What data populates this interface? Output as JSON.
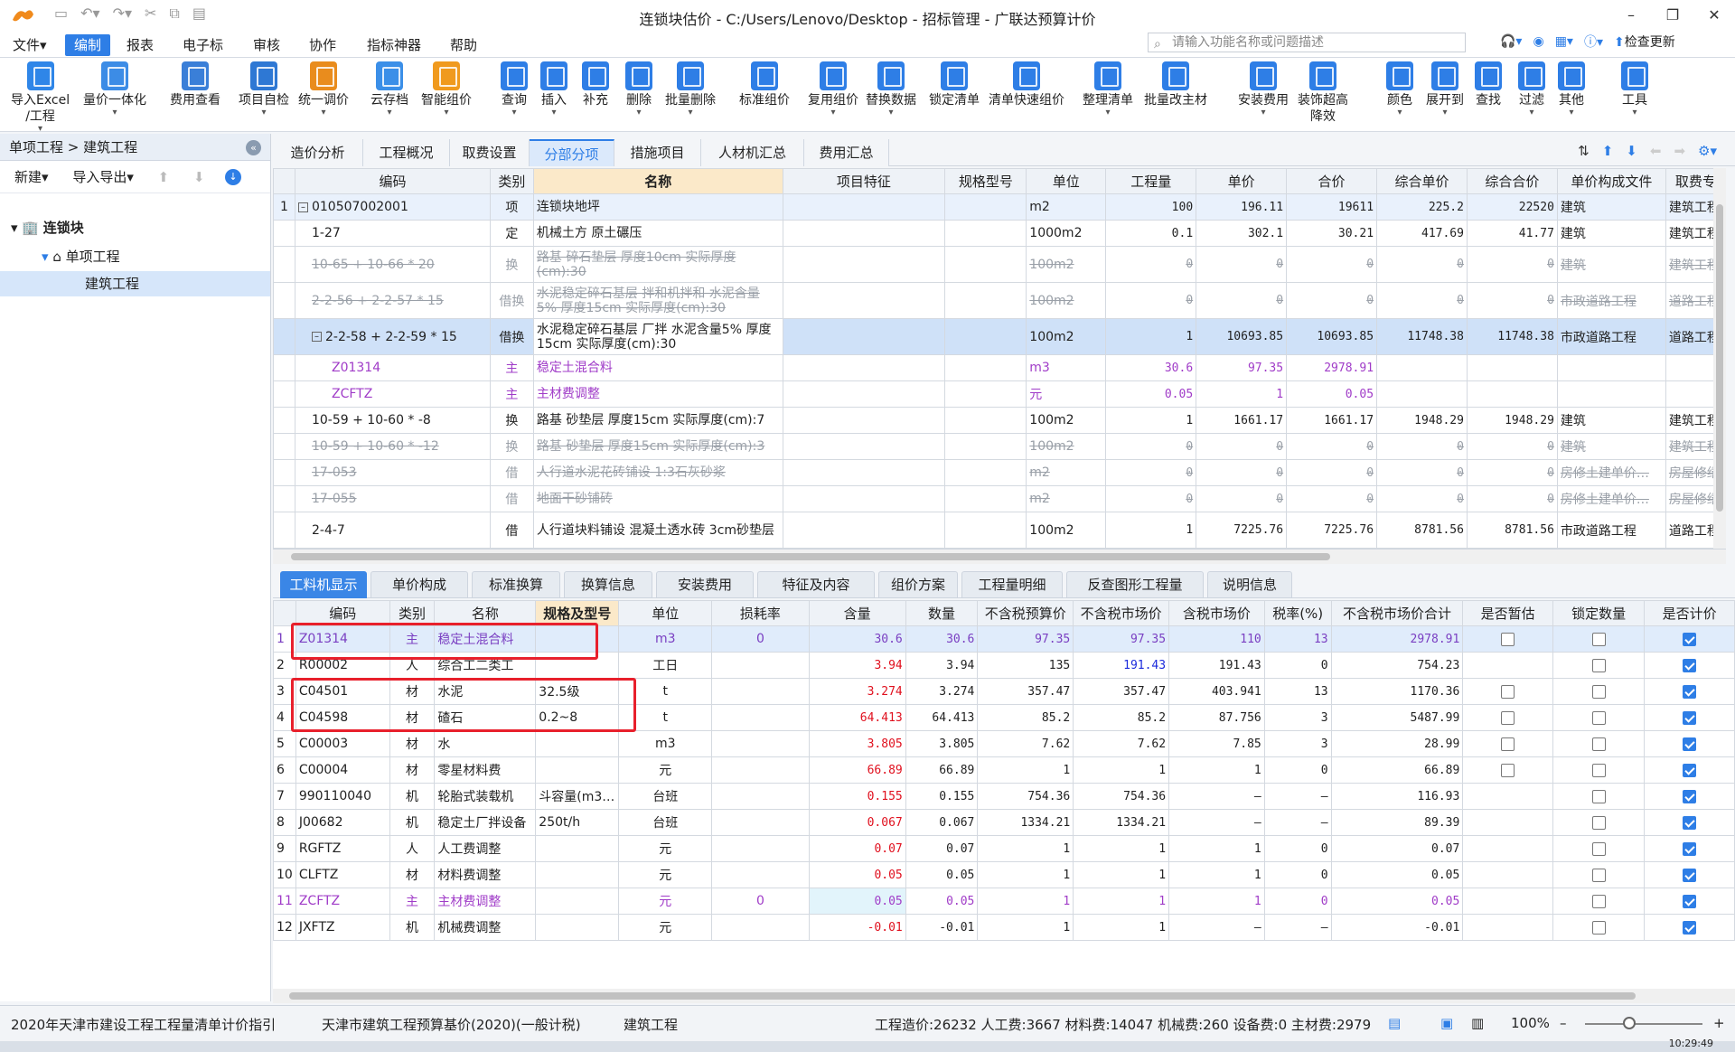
{
  "window": {
    "title": "连锁块估价 - C:/Users/Lenovo/Desktop - 招标管理 - 广联达预算计价"
  },
  "menu": [
    "文件▾",
    "编制",
    "报表",
    "电子标",
    "审核",
    "协作",
    "指标神器",
    "帮助"
  ],
  "search": {
    "placeholder": "请输入功能名称或问题描述"
  },
  "menu_right": {
    "check_update": "检查更新"
  },
  "ribbon": [
    {
      "label": "导入Excel\n/工程",
      "color": "#2f86e8"
    },
    {
      "label": "量价一体化",
      "color": "#3c8ce6"
    },
    {
      "label": "费用查看",
      "color": "#3a7fd8"
    },
    {
      "label": "项目自检",
      "color": "#2e78d4"
    },
    {
      "label": "统一调价",
      "color": "#e98c1d"
    },
    {
      "label": "云存档",
      "color": "#3b8fe8"
    },
    {
      "label": "智能组价",
      "color": "#f09a1e"
    },
    {
      "label": "查询",
      "color": "#2e7ee6"
    },
    {
      "label": "插入",
      "color": "#2e7ee6"
    },
    {
      "label": "补充",
      "color": "#2e7ee6"
    },
    {
      "label": "删除",
      "color": "#2e7ee6"
    },
    {
      "label": "批量删除",
      "color": "#2e7ee6"
    },
    {
      "label": "标准组价",
      "color": "#2e7ee6"
    },
    {
      "label": "复用组价",
      "color": "#2e7ee6"
    },
    {
      "label": "替换数据",
      "color": "#2e7ee6"
    },
    {
      "label": "锁定清单",
      "color": "#2e7ee6"
    },
    {
      "label": "清单快速组价",
      "color": "#2e7ee6"
    },
    {
      "label": "整理清单",
      "color": "#2e7ee6"
    },
    {
      "label": "批量改主材",
      "color": "#2e7ee6"
    },
    {
      "label": "安装费用",
      "color": "#2e7ee6"
    },
    {
      "label": "装饰超高\n降效",
      "color": "#2e7ee6"
    },
    {
      "label": "颜色",
      "color": "#2e7ee6"
    },
    {
      "label": "展开到",
      "color": "#2e7ee6"
    },
    {
      "label": "查找",
      "color": "#2e7ee6"
    },
    {
      "label": "过滤",
      "color": "#2e7ee6"
    },
    {
      "label": "其他",
      "color": "#2e7ee6"
    },
    {
      "label": "工具",
      "color": "#2e7ee6"
    }
  ],
  "left": {
    "breadcrumb": "单项工程 > 建筑工程",
    "new": "新建▾",
    "import_export": "导入导出▾",
    "tree": {
      "root": "连锁块",
      "sub": "单项工程",
      "leaf": "建筑工程"
    }
  },
  "top_tabs": [
    "造价分析",
    "工程概况",
    "取费设置",
    "分部分项",
    "措施项目",
    "人材机汇总",
    "费用汇总"
  ],
  "top_table": {
    "headers": [
      "",
      "编码",
      "类别",
      "名称",
      "项目特征",
      "规格型号",
      "单位",
      "工程量",
      "单价",
      "合价",
      "综合单价",
      "综合合价",
      "单价构成文件",
      "取费专"
    ],
    "rows": [
      [
        "1",
        "010507002001",
        "项",
        "连锁块地坪",
        "",
        "",
        "m2",
        "100",
        "196.11",
        "19611",
        "225.2",
        "22520",
        "建筑",
        "建筑工程"
      ],
      [
        "",
        "1-27",
        "定",
        "机械土方 原土碾压",
        "",
        "",
        "1000m2",
        "0.1",
        "302.1",
        "30.21",
        "417.69",
        "41.77",
        "建筑",
        "建筑工程"
      ],
      [
        "",
        "10-65 + 10-66 * 20",
        "换",
        "路基 碎石垫层 厚度10cm 实际厚度(cm):30",
        "",
        "",
        "100m2",
        "0",
        "0",
        "0",
        "0",
        "0",
        "建筑",
        "建筑工程"
      ],
      [
        "",
        "2-2-56 + 2-2-57 * 15",
        "借换",
        "水泥稳定碎石基层 拌和机拌和 水泥含量5% 厚度15cm 实际厚度(cm):30",
        "",
        "",
        "100m2",
        "0",
        "0",
        "0",
        "0",
        "0",
        "市政道路工程",
        "道路工程"
      ],
      [
        "",
        "2-2-58 + 2-2-59 * 15",
        "借换",
        "水泥稳定碎石基层 厂拌 水泥含量5% 厚度15cm 实际厚度(cm):30",
        "",
        "",
        "100m2",
        "1",
        "10693.85",
        "10693.85",
        "11748.38",
        "11748.38",
        "市政道路工程",
        "道路工程"
      ],
      [
        "",
        "Z01314",
        "主",
        "稳定土混合料",
        "",
        "",
        "m3",
        "30.6",
        "97.35",
        "2978.91",
        "",
        "",
        "",
        ""
      ],
      [
        "",
        "ZCFTZ",
        "主",
        "主材费调整",
        "",
        "",
        "元",
        "0.05",
        "1",
        "0.05",
        "",
        "",
        "",
        ""
      ],
      [
        "",
        "10-59 + 10-60 * -8",
        "换",
        "路基 砂垫层 厚度15cm 实际厚度(cm):7",
        "",
        "",
        "100m2",
        "1",
        "1661.17",
        "1661.17",
        "1948.29",
        "1948.29",
        "建筑",
        "建筑工程"
      ],
      [
        "",
        "10-59 + 10-60 * -12",
        "换",
        "路基 砂垫层 厚度15cm 实际厚度(cm):3",
        "",
        "",
        "100m2",
        "0",
        "0",
        "0",
        "0",
        "0",
        "建筑",
        "建筑工程"
      ],
      [
        "",
        "17-053",
        "借",
        "人行道水泥花砖铺设 1:3石灰砂浆",
        "",
        "",
        "m2",
        "0",
        "0",
        "0",
        "0",
        "0",
        "房修土建单价…",
        "房屋修缮"
      ],
      [
        "",
        "17-055",
        "借",
        "地面干砂铺砖",
        "",
        "",
        "m2",
        "0",
        "0",
        "0",
        "0",
        "0",
        "房修土建单价…",
        "房屋修缮"
      ],
      [
        "",
        "2-4-7",
        "借",
        "人行道块料铺设 混凝土透水砖 3cm砂垫层",
        "",
        "",
        "100m2",
        "1",
        "7225.76",
        "7225.76",
        "8781.56",
        "8781.56",
        "市政道路工程",
        "道路工程"
      ]
    ]
  },
  "bottom_tabs": [
    "工料机显示",
    "单价构成",
    "标准换算",
    "换算信息",
    "安装费用",
    "特征及内容",
    "组价方案",
    "工程量明细",
    "反查图形工程量",
    "说明信息"
  ],
  "bottom_table": {
    "headers": [
      "",
      "编码",
      "类别",
      "名称",
      "规格及型号",
      "单位",
      "损耗率",
      "含量",
      "数量",
      "不含税预算价",
      "不含税市场价",
      "含税市场价",
      "税率(%)",
      "不含税市场价合计",
      "是否暂估",
      "锁定数量",
      "是否计价"
    ],
    "rows": [
      [
        "1",
        "Z01314",
        "主",
        "稳定土混合料",
        "",
        "m3",
        "0",
        "30.6",
        "30.6",
        "97.35",
        "97.35",
        "110",
        "13",
        "2978.91",
        false,
        false,
        true
      ],
      [
        "2",
        "R00002",
        "人",
        "综合工二类工",
        "",
        "工日",
        "",
        "3.94",
        "3.94",
        "135",
        "191.43",
        "191.43",
        "0",
        "754.23",
        null,
        false,
        true
      ],
      [
        "3",
        "C04501",
        "材",
        "水泥",
        "32.5级",
        "t",
        "",
        "3.274",
        "3.274",
        "357.47",
        "357.47",
        "403.941",
        "13",
        "1170.36",
        false,
        false,
        true
      ],
      [
        "4",
        "C04598",
        "材",
        "碴石",
        "0.2~8",
        "t",
        "",
        "64.413",
        "64.413",
        "85.2",
        "85.2",
        "87.756",
        "3",
        "5487.99",
        false,
        false,
        true
      ],
      [
        "5",
        "C00003",
        "材",
        "水",
        "",
        "m3",
        "",
        "3.805",
        "3.805",
        "7.62",
        "7.62",
        "7.85",
        "3",
        "28.99",
        false,
        false,
        true
      ],
      [
        "6",
        "C00004",
        "材",
        "零星材料费",
        "",
        "元",
        "",
        "66.89",
        "66.89",
        "1",
        "1",
        "1",
        "0",
        "66.89",
        false,
        false,
        true
      ],
      [
        "7",
        "990110040",
        "机",
        "轮胎式装载机",
        "斗容量(m3…",
        "台班",
        "",
        "0.155",
        "0.155",
        "754.36",
        "754.36",
        "–",
        "–",
        "116.93",
        null,
        false,
        true
      ],
      [
        "8",
        "J00682",
        "机",
        "稳定土厂拌设备",
        "250t/h",
        "台班",
        "",
        "0.067",
        "0.067",
        "1334.21",
        "1334.21",
        "–",
        "–",
        "89.39",
        null,
        false,
        true
      ],
      [
        "9",
        "RGFTZ",
        "人",
        "人工费调整",
        "",
        "元",
        "",
        "0.07",
        "0.07",
        "1",
        "1",
        "1",
        "0",
        "0.07",
        null,
        false,
        true
      ],
      [
        "10",
        "CLFTZ",
        "材",
        "材料费调整",
        "",
        "元",
        "",
        "0.05",
        "0.05",
        "1",
        "1",
        "1",
        "0",
        "0.05",
        null,
        false,
        true
      ],
      [
        "11",
        "ZCFTZ",
        "主",
        "主材费调整",
        "",
        "元",
        "0",
        "0.05",
        "0.05",
        "1",
        "1",
        "1",
        "0",
        "0.05",
        null,
        false,
        true
      ],
      [
        "12",
        "JXFTZ",
        "机",
        "机械费调整",
        "",
        "元",
        "",
        "-0.01",
        "-0.01",
        "1",
        "1",
        "–",
        "–",
        "-0.01",
        null,
        false,
        true
      ]
    ]
  },
  "status": {
    "s1": "2020年天津市建设工程工程量清单计价指引",
    "s2": "天津市建筑工程预算基价(2020)(一般计税)",
    "s3": "建筑工程",
    "totals": "工程造价:26232  人工费:3667  材料费:14047  机械费:260  设备费:0  主材费:2979",
    "zoom": "100%"
  },
  "clock": "10:29:49"
}
